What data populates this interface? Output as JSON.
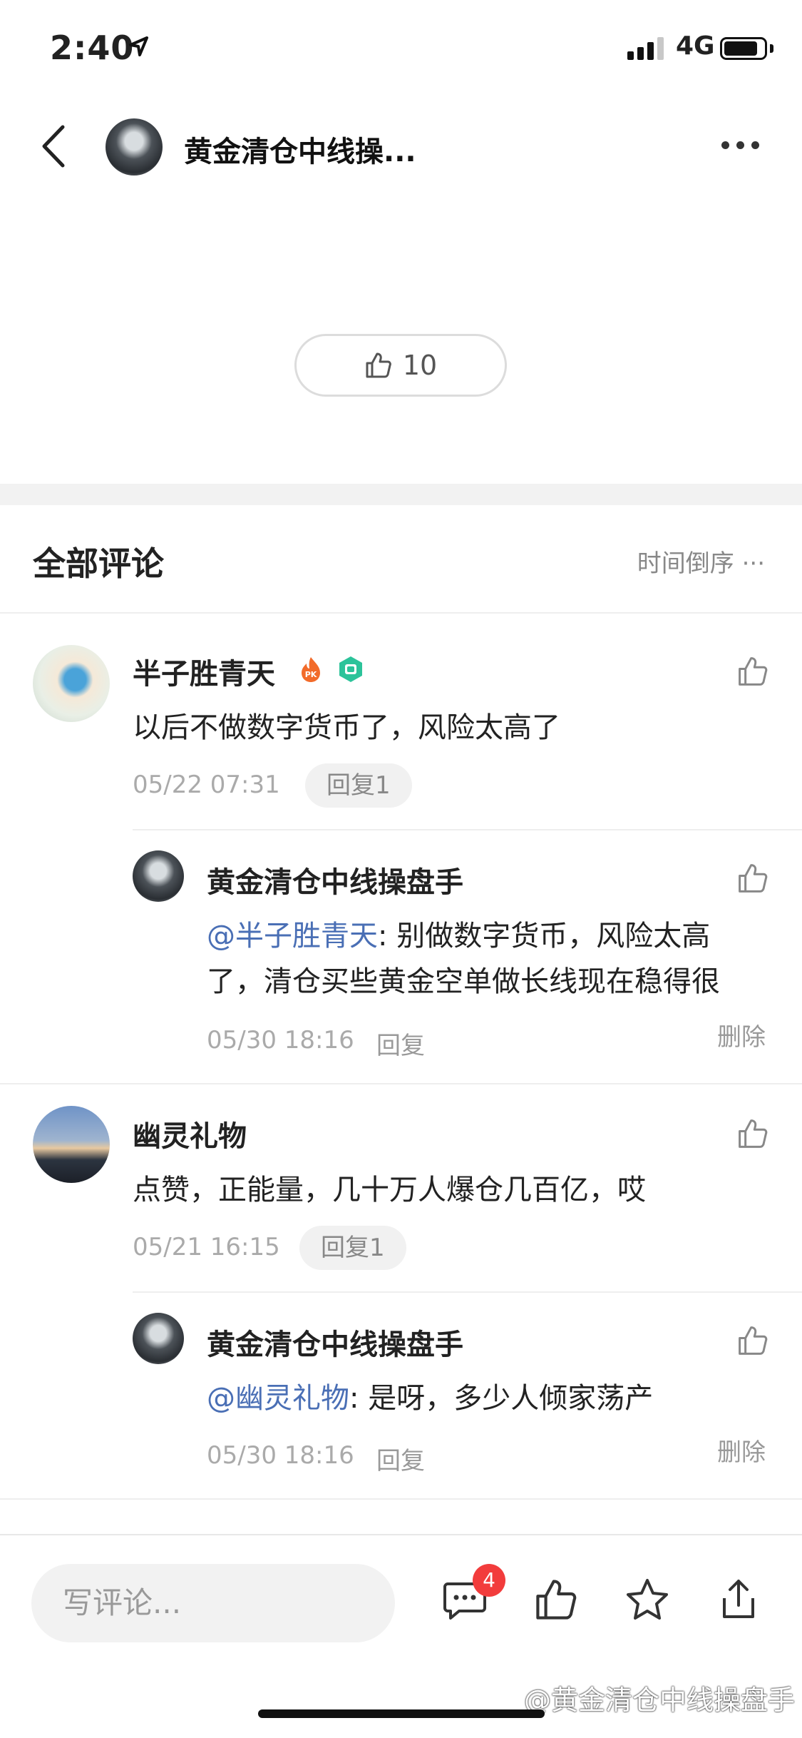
{
  "status_bar": {
    "time": "2:40",
    "network": "4G"
  },
  "nav": {
    "title": "黄金清仓中线操..."
  },
  "post": {
    "like_count": "10"
  },
  "comments_section": {
    "title": "全部评论",
    "sort_label": "时间倒序 ···"
  },
  "comments": [
    {
      "username": "半子胜青天",
      "text": "以后不做数字货币了，风险太高了",
      "time": "05/22 07:31",
      "reply_count_label": "回复1",
      "replies": [
        {
          "username": "黄金清仓中线操盘手",
          "mention": "@半子胜青天",
          "text_line1": ": 别做数字货币，风险太高",
          "text_line2": "了，清仓买些黄金空单做长线现在稳得很",
          "time": "05/30 18:16",
          "reply_label": "回复",
          "delete_label": "删除"
        }
      ]
    },
    {
      "username": "幽灵礼物",
      "text": "点赞，正能量，几十万人爆仓几百亿，哎",
      "time": "05/21 16:15",
      "reply_count_label": "回复1",
      "replies": [
        {
          "username": "黄金清仓中线操盘手",
          "mention": "@幽灵礼物",
          "text_line1": ": 是呀，多少人倾家荡产",
          "time": "05/30 18:16",
          "reply_label": "回复",
          "delete_label": "删除"
        }
      ]
    }
  ],
  "bottom_bar": {
    "input_placeholder": "写评论...",
    "comment_badge": "4",
    "watermark": "@黄金清仓中线操盘手"
  },
  "colors": {
    "mention": "#4a6fb5",
    "badge": "#f23c3c",
    "divider": "#f2f2f2"
  }
}
